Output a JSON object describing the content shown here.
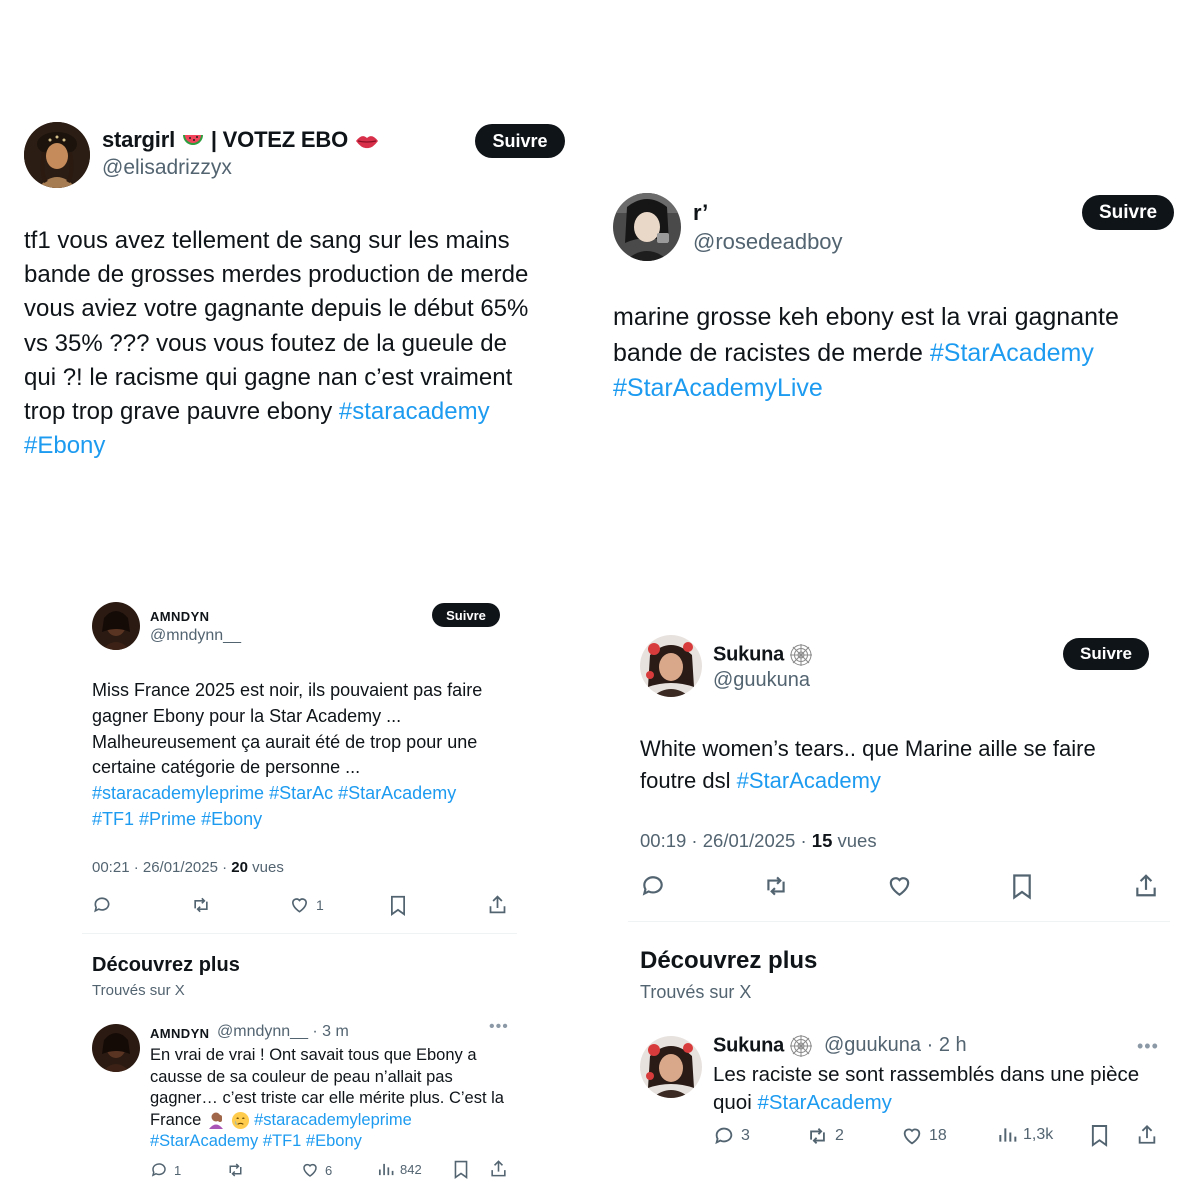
{
  "tweet1": {
    "display_name": "stargirl",
    "name_suffix": " | VOTEZ EBO ",
    "handle": "@elisadrizzyx",
    "follow_label": "Suivre",
    "text_parts": [
      "tf1 vous avez tellement de sang sur les mains",
      "bande de grosses merdes production de merde",
      "vous aviez votre gagnante depuis le début 65%",
      "vs 35% ??? vous vous foutez de la gueule de",
      "qui ?! le racisme qui gagne nan c’est vraiment",
      "trop trop grave pauvre ebony "
    ],
    "hashtags": [
      "#staracademy",
      "#Ebony"
    ]
  },
  "tweet2": {
    "display_name": "r’",
    "handle": "@rosedeadboy",
    "follow_label": "Suivre",
    "text_line1": "marine grosse keh ebony est la vrai gagnante",
    "text_line2": "bande de racistes de merde ",
    "hashtags": [
      "#StarAcademy",
      "#StarAcademyLive"
    ]
  },
  "tweet3": {
    "display_name": "AMNDYN",
    "handle": "@mndynn__",
    "follow_label": "Suivre",
    "text_lines": [
      "Miss France 2025 est noir, ils pouvaient pas faire",
      "gagner Ebony pour la Star Academy ...",
      "Malheureusement ça aurait été de trop pour une",
      "certaine catégorie de personne ..."
    ],
    "hashtags_line1": [
      "#staracademyleprime",
      "#StarAc",
      "#StarAcademy"
    ],
    "hashtags_line2": [
      "#TF1",
      "#Prime",
      "#Ebony"
    ],
    "time": "00:21 · 26/01/2025 · ",
    "views_count": "20",
    "views_label": " vues",
    "likes": "1",
    "discover_title": "Découvrez plus",
    "discover_sub": "Trouvés sur X",
    "reply": {
      "display_name": "AMNDYN",
      "handle_time": "@mndynn__ · 3 m",
      "text_lines": [
        "En vrai de vrai ! Ont savait tous que Ebony a",
        "causse de sa couleur de peau n’allait pas",
        "gagner… c’est triste car elle mérite plus. C’est la"
      ],
      "text_line4_prefix": "France ",
      "hashtags_line4": [
        "#staracademyleprime"
      ],
      "hashtags_line5": [
        "#StarAcademy",
        "#TF1",
        "#Ebony"
      ],
      "replies": "1",
      "likes": "6",
      "views": "842"
    }
  },
  "tweet4": {
    "display_name": "Sukuna",
    "handle": "@guukuna",
    "follow_label": "Suivre",
    "text_line1": "White women’s tears.. que Marine aille se faire",
    "text_line2": "foutre dsl ",
    "hashtags": [
      "#StarAcademy"
    ],
    "time": "00:19 · 26/01/2025 · ",
    "views_count": "15",
    "views_label": " vues",
    "discover_title": "Découvrez plus",
    "discover_sub": "Trouvés sur X",
    "reply": {
      "display_name": "Sukuna",
      "handle_time": "@guukuna · 2 h",
      "text_line1": "Les raciste se sont rassemblés dans une pièce",
      "text_line2": "quoi  ",
      "hashtags": [
        "#StarAcademy"
      ],
      "replies": "3",
      "reposts": "2",
      "likes": "18",
      "views": "1,3k"
    }
  },
  "colors": {
    "text": "#0f1419",
    "secondary": "#536471",
    "link": "#1d9bf0",
    "button": "#0f1419"
  }
}
